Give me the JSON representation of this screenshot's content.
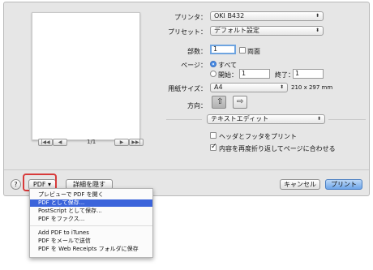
{
  "preview": {
    "page_label": "1/1"
  },
  "form": {
    "printer_label": "プリンタ：",
    "printer_value": "OKI B432",
    "preset_label": "プリセット：",
    "preset_value": "デフォルト設定",
    "copies_label": "部数：",
    "copies_value": "1",
    "duplex_label": "両面",
    "pages_label": "ページ：",
    "all_label": "すべて",
    "from_label": "開始：",
    "from_value": "1",
    "to_label": "終了：",
    "to_value": "1",
    "paper_label": "用紙サイズ：",
    "paper_value": "A4",
    "paper_dims": "210 x 297 mm",
    "orientation_label": "方向：",
    "app_panel_value": "テキストエディット",
    "header_footer_label": "ヘッダとフッタをプリント",
    "rewrap_label": "内容を再度折り返してページに合わせる"
  },
  "bottom": {
    "help_label": "?",
    "pdf_label": "PDF ▾",
    "hide_details_label": "詳細を隠す",
    "cancel_label": "キャンセル",
    "print_label": "プリント"
  },
  "pdf_menu": {
    "items": [
      "プレビューで PDF を開く",
      "PDF として保存...",
      "PostScript として保存...",
      "PDF をファクス...",
      "Add PDF to iTunes",
      "PDF をメールで送信",
      "PDF を Web Receipts フォルダに保存"
    ],
    "selected_index": 1
  },
  "colors": {
    "accent": "#3b64db",
    "highlight": "#d83a3a"
  }
}
